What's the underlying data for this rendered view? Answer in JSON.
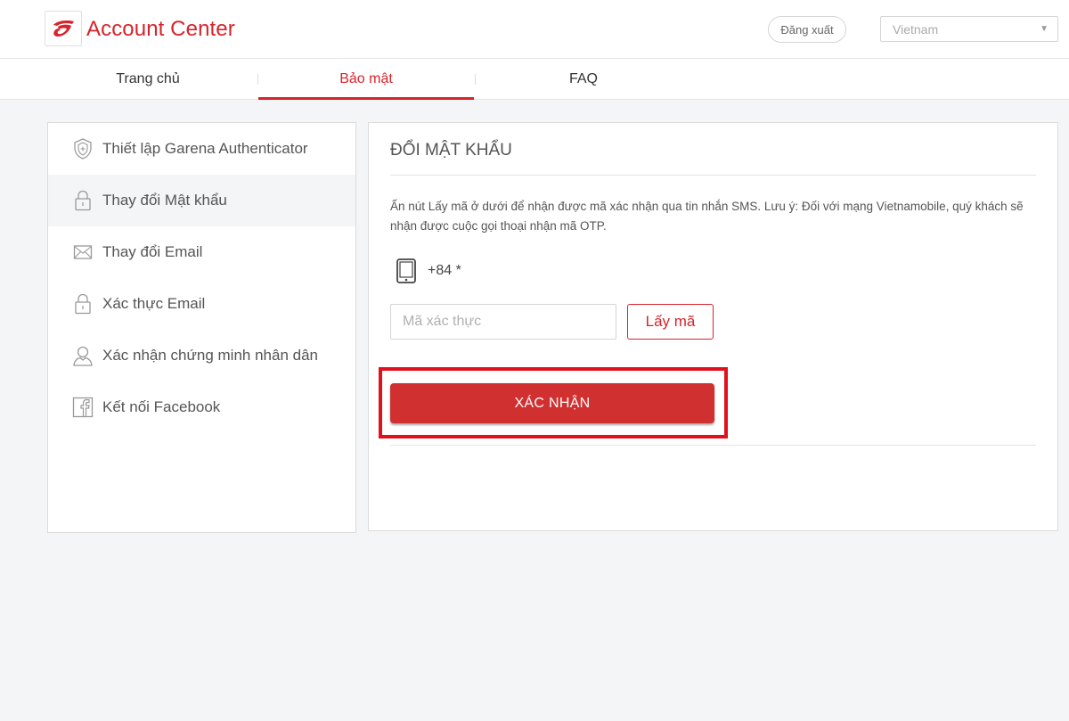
{
  "header": {
    "brand": "Account Center",
    "logout_label": "Đăng xuất",
    "language": "Vietnam"
  },
  "tabs": [
    {
      "label": "Trang chủ",
      "active": false
    },
    {
      "label": "Bảo mật",
      "active": true
    },
    {
      "label": "FAQ",
      "active": false
    }
  ],
  "sidebar": {
    "items": [
      {
        "label": "Thiết lập Garena Authenticator",
        "icon": "shield-icon"
      },
      {
        "label": "Thay đổi Mật khẩu",
        "icon": "lock-icon",
        "active": true
      },
      {
        "label": "Thay đổi Email",
        "icon": "mail-icon"
      },
      {
        "label": "Xác thực Email",
        "icon": "lock-icon"
      },
      {
        "label": "Xác nhận chứng minh nhân dân",
        "icon": "user-icon"
      },
      {
        "label": "Kết nối Facebook",
        "icon": "facebook-icon"
      }
    ]
  },
  "main": {
    "title": "ĐỔI MẬT KHẨU",
    "description": "Ấn nút Lấy mã ở dưới để nhận được mã xác nhận qua tin nhắn SMS. Lưu ý: Đối với mạng Vietnamobile, quý khách sẽ nhận được cuộc gọi thoại nhận mã OTP.",
    "phone": "+84 *",
    "code_placeholder": "Mã xác thực",
    "get_code_label": "Lấy mã",
    "confirm_label": "XÁC NHẬN"
  },
  "colors": {
    "brand_red": "#d7242b",
    "confirm_button": "#d03030",
    "highlight_border": "#e0101c",
    "page_background": "#f4f5f7"
  }
}
